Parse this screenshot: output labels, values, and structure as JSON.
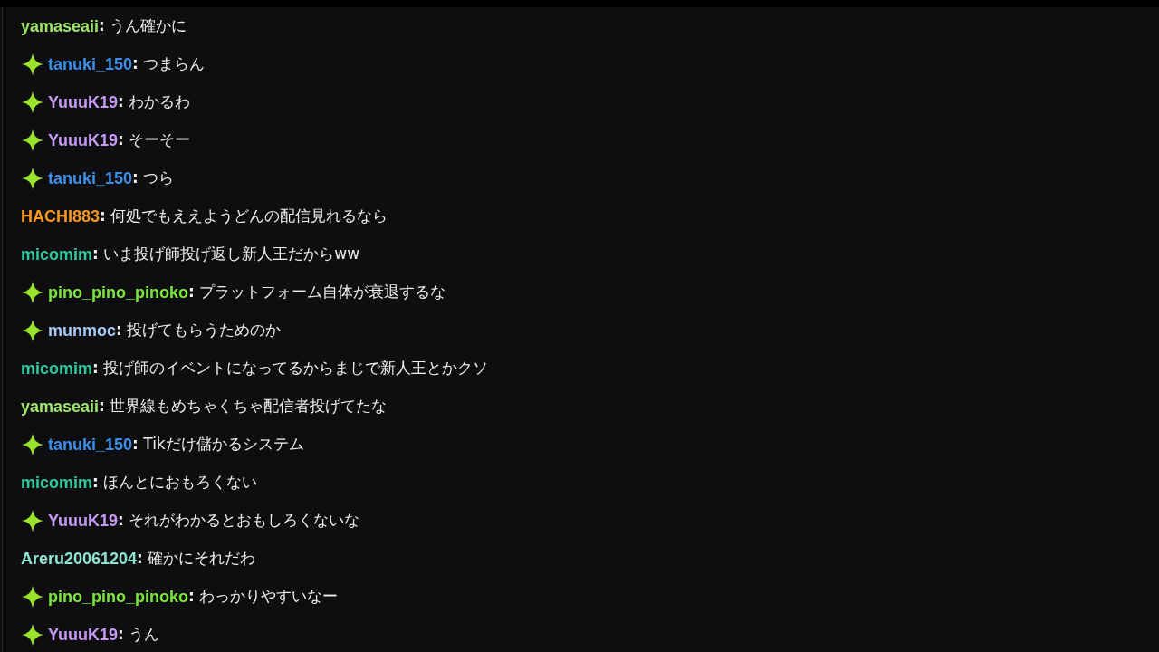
{
  "separator": ":",
  "messages": [
    {
      "user": "yamaseaii",
      "color": "#9ee66a",
      "badge": false,
      "text": "うん確かに"
    },
    {
      "user": "tanuki_150",
      "color": "#3c8fe8",
      "badge": true,
      "text": "つまらん"
    },
    {
      "user": "YuuuK19",
      "color": "#c79af5",
      "badge": true,
      "text": "わかるわ"
    },
    {
      "user": "YuuuK19",
      "color": "#c79af5",
      "badge": true,
      "text": "そーそー"
    },
    {
      "user": "tanuki_150",
      "color": "#3c8fe8",
      "badge": true,
      "text": "つら"
    },
    {
      "user": "HACHI883",
      "color": "#f7981d",
      "badge": false,
      "text": "何処でもええようどんの配信見れるなら"
    },
    {
      "user": "micomim",
      "color": "#2ec99a",
      "badge": false,
      "text": "いま投げ師投げ返し新人王だからww"
    },
    {
      "user": "pino_pino_pinoko",
      "color": "#7ce63a",
      "badge": true,
      "text": "プラットフォーム自体が衰退するな"
    },
    {
      "user": "munmoc",
      "color": "#a8c8f5",
      "badge": true,
      "text": "投げてもらうためのか"
    },
    {
      "user": "micomim",
      "color": "#2ec99a",
      "badge": false,
      "text": "投げ師のイベントになってるからまじで新人王とかクソ"
    },
    {
      "user": "yamaseaii",
      "color": "#9ee66a",
      "badge": false,
      "text": "世界線もめちゃくちゃ配信者投げてたな"
    },
    {
      "user": "tanuki_150",
      "color": "#3c8fe8",
      "badge": true,
      "text": "Tikだけ儲かるシステム"
    },
    {
      "user": "micomim",
      "color": "#2ec99a",
      "badge": false,
      "text": "ほんとにおもろくない"
    },
    {
      "user": "YuuuK19",
      "color": "#c79af5",
      "badge": true,
      "text": "それがわかるとおもしろくないな"
    },
    {
      "user": "Areru20061204",
      "color": "#8fe6cf",
      "badge": false,
      "text": "確かにそれだわ"
    },
    {
      "user": "pino_pino_pinoko",
      "color": "#7ce63a",
      "badge": true,
      "text": "わっかりやすいなー"
    },
    {
      "user": "YuuuK19",
      "color": "#c79af5",
      "badge": true,
      "text": "うん"
    }
  ]
}
